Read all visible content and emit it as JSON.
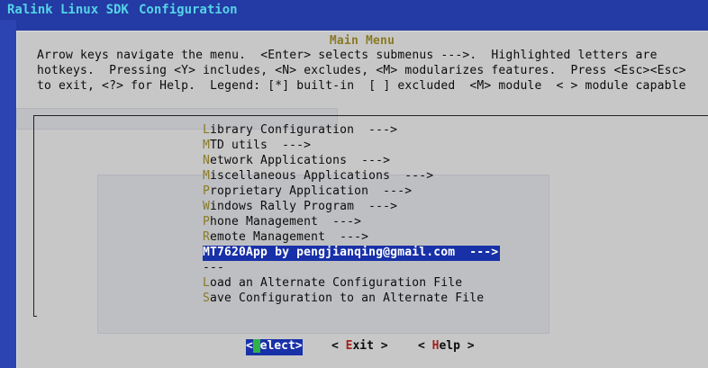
{
  "window": {
    "app_title": "Ralink Linux SDK",
    "section_title": "Configuration"
  },
  "dialog": {
    "title": "Main Menu",
    "help_lines": [
      "Arrow keys navigate the menu.  <Enter> selects submenus --->.  Highlighted letters are",
      "hotkeys.  Pressing <Y> includes, <N> excludes, <M> modularizes features.  Press <Esc><Esc>",
      "to exit, <?> for Help.  Legend: [*] built-in  [ ] excluded  <M> module  < > module capable"
    ],
    "menu_items": [
      {
        "hotkey": "L",
        "rest": "ibrary Configuration  --->"
      },
      {
        "hotkey": "M",
        "rest": "TD utils  --->"
      },
      {
        "hotkey": "N",
        "rest": "etwork Applications  --->"
      },
      {
        "hotkey": "M",
        "rest": "iscellaneous Applications  --->"
      },
      {
        "hotkey": "P",
        "rest": "roprietary Application  --->"
      },
      {
        "hotkey": "W",
        "rest": "indows Rally Program  --->"
      },
      {
        "hotkey": "P",
        "rest": "hone Management  --->"
      },
      {
        "hotkey": "R",
        "rest": "emote Management  --->"
      },
      {
        "hotkey": "M",
        "rest": "T7620App by pengjianqing@gmail.com  --->"
      },
      {
        "hotkey": "",
        "rest": "---"
      },
      {
        "hotkey": "L",
        "rest": "oad an Alternate Configuration File"
      },
      {
        "hotkey": "S",
        "rest": "ave Configuration to an Alternate File"
      }
    ],
    "selected_index": 8,
    "buttons": {
      "select": {
        "open": "<",
        "cursor": "S",
        "rest": "elect",
        "close": ">"
      },
      "exit": {
        "open": "< ",
        "hotkey": "E",
        "rest": "xit",
        "close": " >"
      },
      "help": {
        "open": "< ",
        "hotkey": "H",
        "rest": "elp",
        "close": " >"
      }
    }
  },
  "colors": {
    "terminal_background": "#243aa4",
    "dialog_background": "#c7c7c7",
    "title_text": "#55d3e6",
    "hotkey": "#8a7a24",
    "selection": "#1830a8",
    "cursor": "#2fb24a",
    "button_hotkey": "#a2221e"
  }
}
